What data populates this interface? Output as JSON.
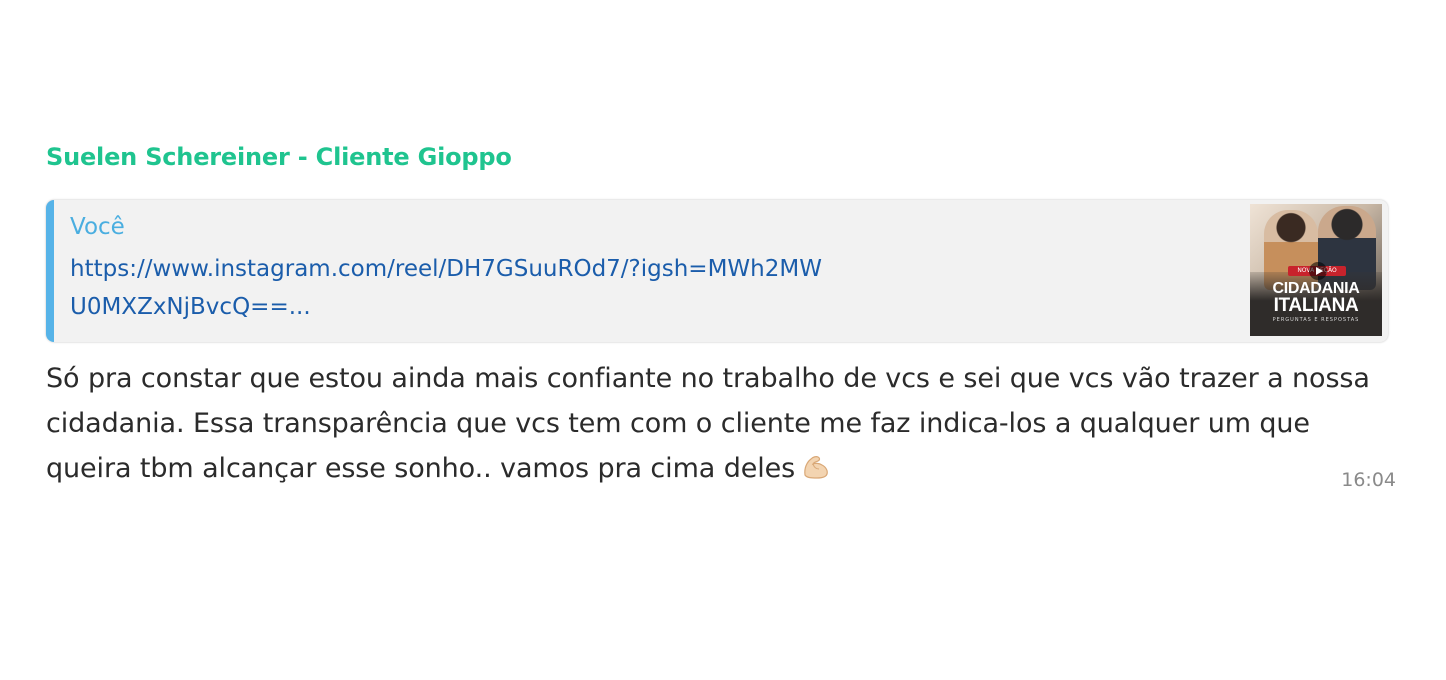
{
  "message": {
    "sender": "Suelen Schereiner - Cliente Gioppo",
    "quoted": {
      "author": "Você",
      "link": "https://www.instagram.com/reel/DH7GSuuROd7/?igsh=MWh2MWU0MXZxNjBvcQ==...",
      "thumbnail": {
        "badge": "NOVA SEÇÃO",
        "title_line1": "CIDADANIA",
        "title_line2": "ITALIANA",
        "subtitle": "PERGUNTAS E RESPOSTAS",
        "icon": "play-icon"
      }
    },
    "text": "Só pra constar que estou ainda mais confiante no trabalho de vcs e sei que vcs vão trazer a nossa cidadania. Essa transparência que vcs tem com o cliente me faz indica-los a qualquer um que queira tbm alcançar esse sonho.. vamos pra cima deles",
    "emoji": "flexed-biceps-icon",
    "time": "16:04"
  },
  "colors": {
    "sender": "#1fc48f",
    "quote_bar": "#56b3e8",
    "quote_author": "#4aaee0",
    "link": "#1b5dab",
    "text": "#2b2b2b",
    "time": "#8a8a8a"
  }
}
